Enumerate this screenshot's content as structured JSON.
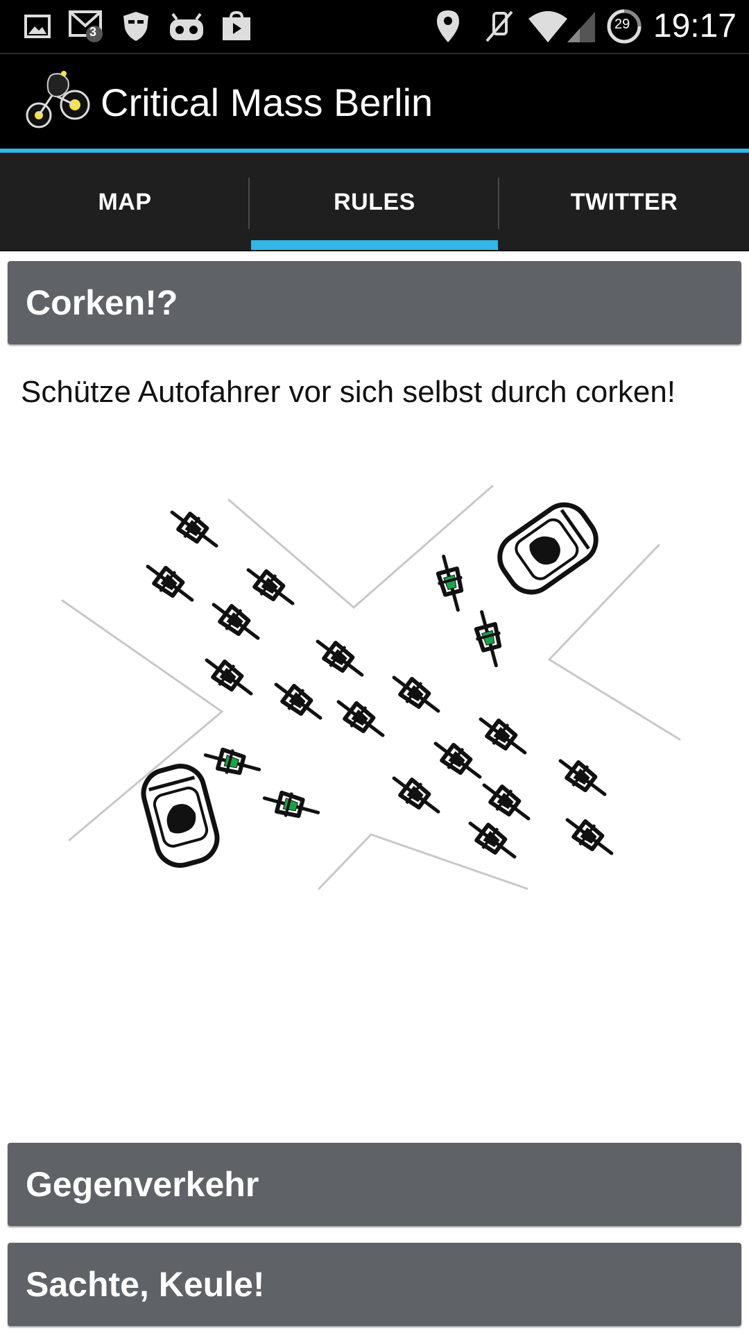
{
  "status_bar": {
    "time": "19:17",
    "notification_count": "3",
    "battery_level": "29",
    "icons": [
      "image-icon",
      "mail-icon",
      "shield-icon",
      "android-mascot-icon",
      "shopping-bag-icon",
      "location-icon",
      "muted-icon",
      "wifi-icon",
      "signal-icon",
      "battery-icon"
    ]
  },
  "action_bar": {
    "title": "Critical Mass Berlin",
    "logo": "bicycle-logo-icon"
  },
  "tabs": [
    {
      "label": "MAP",
      "selected": false
    },
    {
      "label": "RULES",
      "selected": true
    },
    {
      "label": "TWITTER",
      "selected": false
    }
  ],
  "rules": [
    {
      "title": "Corken!?",
      "text": "Schütze Autofahrer vor sich selbst durch corken!",
      "expanded": true,
      "illustration": "corking-intersection-illustration"
    },
    {
      "title": "Gegenverkehr",
      "expanded": false
    },
    {
      "title": "Sachte, Keule!",
      "expanded": false
    }
  ],
  "colors": {
    "accent": "#33b5e5",
    "header_bg": "#5f6266",
    "tabbar_bg": "#1f1f1f",
    "cork_green": "#1aa34a"
  }
}
